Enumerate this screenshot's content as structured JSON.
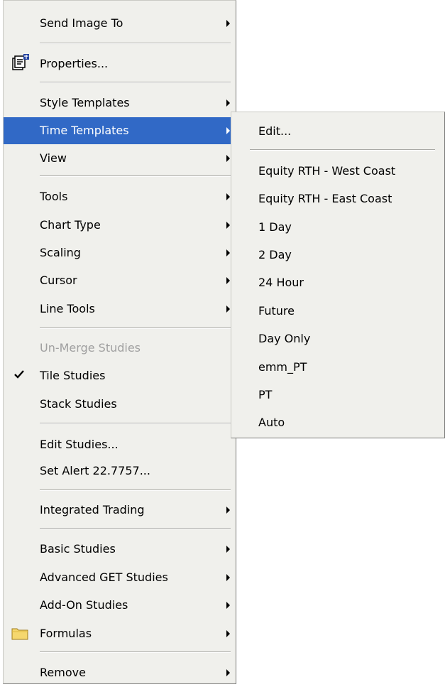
{
  "main_menu": {
    "items": [
      {
        "label": "Send Image To"
      },
      {
        "label": "Properties..."
      },
      {
        "label": "Style Templates"
      },
      {
        "label": "Time Templates"
      },
      {
        "label": "View"
      },
      {
        "label": "Tools"
      },
      {
        "label": "Chart Type"
      },
      {
        "label": "Scaling"
      },
      {
        "label": "Cursor"
      },
      {
        "label": "Line Tools"
      },
      {
        "label": "Un-Merge Studies"
      },
      {
        "label": "Tile Studies"
      },
      {
        "label": "Stack Studies"
      },
      {
        "label": "Edit Studies..."
      },
      {
        "label": "Set Alert 22.7757..."
      },
      {
        "label": "Integrated Trading"
      },
      {
        "label": "Basic Studies"
      },
      {
        "label": "Advanced GET Studies"
      },
      {
        "label": "Add-On Studies"
      },
      {
        "label": "Formulas"
      },
      {
        "label": "Remove"
      }
    ]
  },
  "time_templates_submenu": {
    "items": [
      {
        "label": "Edit..."
      },
      {
        "label": "Equity RTH - West Coast"
      },
      {
        "label": "Equity RTH - East Coast"
      },
      {
        "label": "1 Day"
      },
      {
        "label": "2 Day"
      },
      {
        "label": "24 Hour"
      },
      {
        "label": "Future"
      },
      {
        "label": "Day Only"
      },
      {
        "label": "emm_PT"
      },
      {
        "label": "PT"
      },
      {
        "label": "Auto"
      }
    ]
  },
  "colors": {
    "menu_background": "#f0f0ec",
    "highlight": "#3169c6",
    "disabled_text": "#a0a0a0"
  }
}
